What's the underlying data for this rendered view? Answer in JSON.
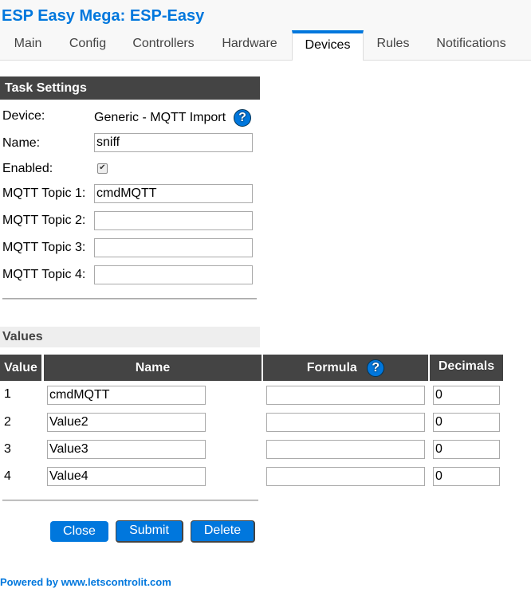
{
  "app": {
    "title": "ESP Easy Mega: ESP-Easy"
  },
  "nav": {
    "tabs": [
      {
        "label": "Main",
        "active": false
      },
      {
        "label": "Config",
        "active": false
      },
      {
        "label": "Controllers",
        "active": false
      },
      {
        "label": "Hardware",
        "active": false
      },
      {
        "label": "Devices",
        "active": true
      },
      {
        "label": "Rules",
        "active": false
      },
      {
        "label": "Notifications",
        "active": false
      }
    ]
  },
  "task_settings": {
    "heading": "Task Settings",
    "device_label": "Device:",
    "device_value": "Generic - MQTT Import",
    "help_icon": "?",
    "name_label": "Name:",
    "name_value": "sniff",
    "enabled_label": "Enabled:",
    "enabled_checked": true,
    "enabled_glyph": "✔",
    "topics": [
      {
        "label": "MQTT Topic 1:",
        "value": "cmdMQTT"
      },
      {
        "label": "MQTT Topic 2:",
        "value": ""
      },
      {
        "label": "MQTT Topic 3:",
        "value": ""
      },
      {
        "label": "MQTT Topic 4:",
        "value": ""
      }
    ]
  },
  "values": {
    "heading": "Values",
    "columns": {
      "value": "Value",
      "name": "Name",
      "formula": "Formula",
      "decimals": "Decimals"
    },
    "formula_help_icon": "?",
    "rows": [
      {
        "num": "1",
        "name": "cmdMQTT",
        "formula": "",
        "decimals": "0"
      },
      {
        "num": "2",
        "name": "Value2",
        "formula": "",
        "decimals": "0"
      },
      {
        "num": "3",
        "name": "Value3",
        "formula": "",
        "decimals": "0"
      },
      {
        "num": "4",
        "name": "Value4",
        "formula": "",
        "decimals": "0"
      }
    ]
  },
  "buttons": {
    "close": "Close",
    "submit": "Submit",
    "delete": "Delete"
  },
  "footer": {
    "text": "Powered by www.letscontrolit.com"
  },
  "colors": {
    "accent": "#0077dd",
    "header_bg": "#444444",
    "values_bg": "#eeeeee"
  }
}
